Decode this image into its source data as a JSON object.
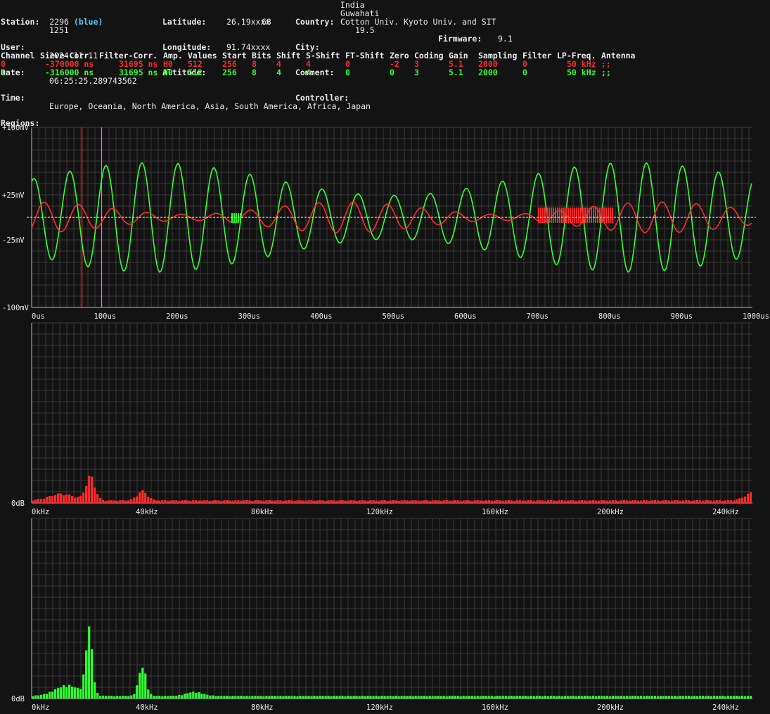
{
  "station": {
    "station_label": "Station:",
    "station_value": "2296",
    "station_color": "(blue)",
    "user_label": "User:",
    "user_value": "1251",
    "date_label": "Date:",
    "date_value": "2024-11-11",
    "time_label": "Time:",
    "time_value": "06:25:25.289743562",
    "regions_label": "Regions:",
    "regions_value": "Europe, Oceania, North America, Asia, South America, Africa, Japan",
    "lat_label": "Latitude:",
    "lat_value": "26.19xxxx",
    "lon_label": "Longitude:",
    "lon_value": "91.74xxxx",
    "alt_label": "Altitude:",
    "alt_value": "68",
    "country_label": "Country:",
    "country_value": "India",
    "city_label": "City:",
    "city_value": "Guwahati",
    "comment_label": "Comment:",
    "comment_value": "Cotton Univ. Kyoto Univ. and SIT",
    "controller_label": "Controller:",
    "controller_value": "19.5",
    "firmware_label": "Firmware:",
    "firmware_value": "9.1"
  },
  "channels": {
    "headers": [
      "Channel",
      "Sieve-Corr.",
      "Filter-Corr.",
      "Amp.",
      "Values",
      "Start",
      "Bits",
      "Shift",
      "S-Shift",
      "FT-Shift",
      "Zero",
      "Coding",
      "Gain",
      "Sampling",
      "Filter",
      "LP-Freq.",
      "Antenna"
    ],
    "rows": [
      [
        "0",
        "-370000 ns",
        "31695 ns",
        "H0",
        "512",
        "256",
        "8",
        "4",
        "4",
        "0",
        "-2",
        "3",
        "5.1",
        "2000",
        "0",
        "50 kHz",
        ";;"
      ],
      [
        "1",
        "-316000 ns",
        "31695 ns",
        "H0",
        "512",
        "256",
        "8",
        "4",
        "4",
        "0",
        "0",
        "3",
        "5.1",
        "2000",
        "0",
        "50 kHz",
        ";;"
      ]
    ],
    "row_colors": [
      "#ff2a2a",
      "#30ff30"
    ]
  },
  "waveform": {
    "y_labels": [
      "+100mV",
      "+25mV",
      "-25mV",
      "-100mV"
    ],
    "y_values": [
      100,
      25,
      -25,
      -100
    ],
    "x_labels": [
      "0us",
      "100us",
      "200us",
      "300us",
      "400us",
      "500us",
      "600us",
      "700us",
      "800us",
      "900us",
      "1000us"
    ],
    "xlim": [
      0,
      1000
    ],
    "ylim": [
      -100,
      100
    ],
    "markers": [
      {
        "t": 70,
        "color": "#ff2a2a"
      },
      {
        "t": 97,
        "color": "#30ff30"
      }
    ],
    "colors": {
      "ch0": "#ff2a2a",
      "ch1": "#30ff30",
      "zero": "#ffffff"
    }
  },
  "spectrum_ch0": {
    "y_label": "0dB",
    "x_labels": [
      "0kHz",
      "40kHz",
      "80kHz",
      "120kHz",
      "160kHz",
      "200kHz",
      "240kHz"
    ],
    "xlim": [
      0,
      250
    ],
    "color": "#ff2a2a"
  },
  "spectrum_ch1": {
    "y_label": "0dB",
    "x_labels": [
      "0kHz",
      "40kHz",
      "80kHz",
      "120kHz",
      "160kHz",
      "200kHz",
      "240kHz"
    ],
    "xlim": [
      0,
      250
    ],
    "color": "#30ff30"
  }
}
